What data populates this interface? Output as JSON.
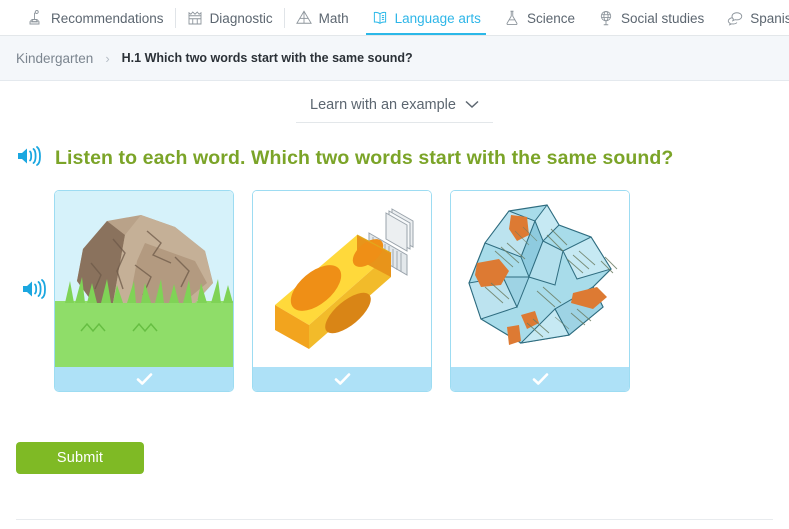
{
  "nav": {
    "items": [
      {
        "label": "Recommendations",
        "icon": "podium-icon",
        "active": false
      },
      {
        "label": "Diagnostic",
        "icon": "castle-icon",
        "active": false
      },
      {
        "label": "Math",
        "icon": "pyramid-icon",
        "active": false
      },
      {
        "label": "Language arts",
        "icon": "open-book-icon",
        "active": true
      },
      {
        "label": "Science",
        "icon": "flask-icon",
        "active": false
      },
      {
        "label": "Social studies",
        "icon": "globe-icon",
        "active": false
      },
      {
        "label": "Spanish",
        "icon": "speech-bubbles-icon",
        "active": false
      }
    ]
  },
  "breadcrumb": {
    "grade": "Kindergarten",
    "separator": "›",
    "skill": "H.1 Which two words start with the same sound?"
  },
  "example": {
    "label": "Learn with an example",
    "chevron": "chevron-down-icon"
  },
  "question": {
    "speaker_icon": "speaker-icon",
    "text": "Listen to each word. Which two words start with the same sound?"
  },
  "answers": {
    "speaker_icon": "speaker-icon",
    "options": [
      {
        "name": "rock",
        "check_icon": "check-icon",
        "selected": false
      },
      {
        "name": "matches",
        "check_icon": "check-icon",
        "selected": false
      },
      {
        "name": "map",
        "check_icon": "check-icon",
        "selected": false
      }
    ]
  },
  "submit": {
    "label": "Submit"
  },
  "colors": {
    "accent_blue": "#2bb8e8",
    "question_green": "#7ba428",
    "submit_green": "#7fba25",
    "card_border": "#9ddcf2",
    "check_bar": "#aee1f7",
    "breadcrumb_bg": "#f4f7fa"
  }
}
